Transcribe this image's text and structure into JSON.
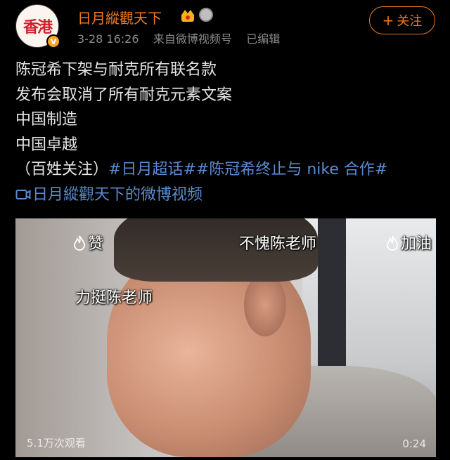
{
  "user": {
    "name": "日月縱觀天下",
    "avatar_text": "香港",
    "verified_badge": "V"
  },
  "meta": {
    "time": "3-28 16:26",
    "source_prefix": "来自",
    "source": "微博视频号",
    "edited": "已编辑"
  },
  "follow_button": {
    "plus": "+",
    "label": "关注"
  },
  "post": {
    "lines": [
      "陈冠希下架与耐克所有联名款",
      "发布会取消了所有耐克元素文案",
      "中国制造",
      "中国卓越"
    ],
    "last_line_prefix": "（百姓关注）",
    "hashtag_1": "#日月超话#",
    "hashtag_2": "#陈冠希终止与 nike 合作#",
    "video_link": "日月縱觀天下的微博视频"
  },
  "video": {
    "danmaku": {
      "zan": "赞",
      "buwei": "不愧陈老师",
      "jiayou": "加油",
      "liting": "力挺陈老师"
    },
    "stats": "5.1万次观看",
    "duration": "0:24"
  },
  "colors": {
    "accent": "#f07a1f",
    "link": "#5b8bd0",
    "background": "#000000"
  }
}
